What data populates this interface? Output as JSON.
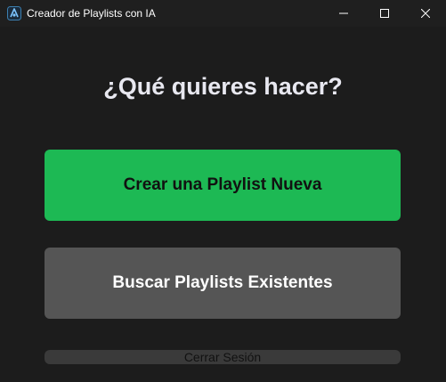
{
  "window": {
    "title": "Creador de Playlists con IA",
    "controls": {
      "minimize_icon": "minimize-icon",
      "maximize_icon": "maximize-icon",
      "close_icon": "close-icon"
    }
  },
  "main": {
    "heading": "¿Qué quieres hacer?",
    "create_label": "Crear una Playlist Nueva",
    "search_label": "Buscar Playlists Existentes",
    "logout_label": "Cerrar Sesión"
  },
  "colors": {
    "background": "#1c1c1c",
    "accent_green": "#1db954",
    "secondary_button": "#555555",
    "logout_button": "#3a3a3a"
  }
}
